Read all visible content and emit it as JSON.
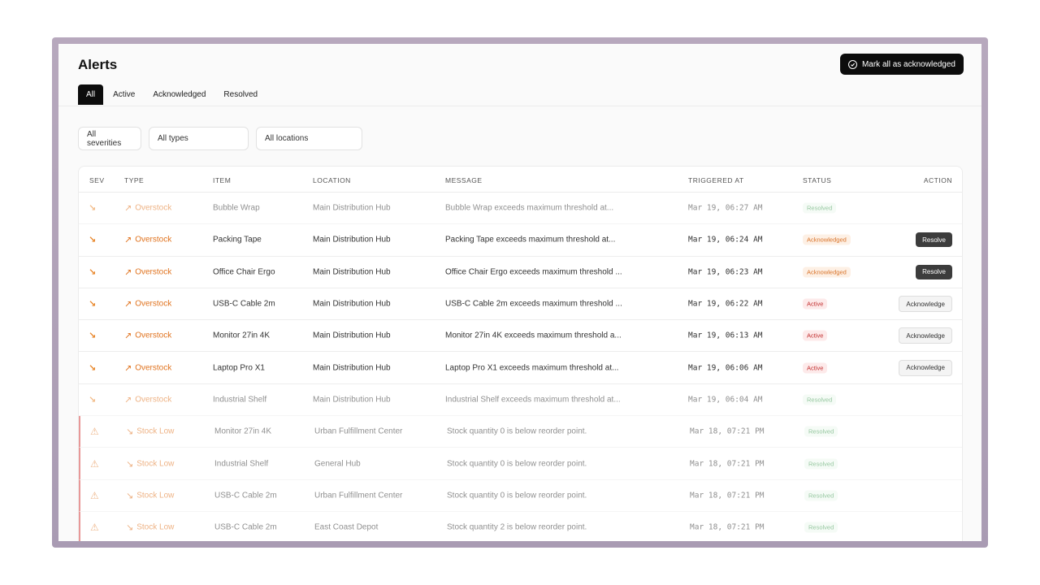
{
  "header": {
    "title": "Alerts",
    "mark_all_label": "Mark all as acknowledged"
  },
  "tabs": [
    {
      "label": "All"
    },
    {
      "label": "Active"
    },
    {
      "label": "Acknowledged"
    },
    {
      "label": "Resolved"
    }
  ],
  "filters": {
    "severity": "All severities",
    "type": "All types",
    "location": "All locations"
  },
  "columns": {
    "sev": "SEV",
    "type": "TYPE",
    "item": "ITEM",
    "location": "LOCATION",
    "message": "MESSAGE",
    "triggered_at": "TRIGGERED AT",
    "status": "STATUS",
    "action": "ACTION"
  },
  "rows": [
    {
      "type": "Overstock",
      "item": "Bubble Wrap",
      "location": "Main Distribution Hub",
      "message": "Bubble Wrap exceeds maximum threshold at...",
      "triggered_at": "Mar 19, 06:27 AM",
      "status": "Resolved",
      "action": ""
    },
    {
      "type": "Overstock",
      "item": "Packing Tape",
      "location": "Main Distribution Hub",
      "message": "Packing Tape exceeds maximum threshold at...",
      "triggered_at": "Mar 19, 06:24 AM",
      "status": "Acknowledged",
      "action": "Resolve"
    },
    {
      "type": "Overstock",
      "item": "Office Chair Ergo",
      "location": "Main Distribution Hub",
      "message": "Office Chair Ergo exceeds maximum threshold ...",
      "triggered_at": "Mar 19, 06:23 AM",
      "status": "Acknowledged",
      "action": "Resolve"
    },
    {
      "type": "Overstock",
      "item": "USB-C Cable 2m",
      "location": "Main Distribution Hub",
      "message": "USB-C Cable 2m exceeds maximum threshold ...",
      "triggered_at": "Mar 19, 06:22 AM",
      "status": "Active",
      "action": "Acknowledge"
    },
    {
      "type": "Overstock",
      "item": "Monitor 27in 4K",
      "location": "Main Distribution Hub",
      "message": "Monitor 27in 4K exceeds maximum threshold a...",
      "triggered_at": "Mar 19, 06:13 AM",
      "status": "Active",
      "action": "Acknowledge"
    },
    {
      "type": "Overstock",
      "item": "Laptop Pro X1",
      "location": "Main Distribution Hub",
      "message": "Laptop Pro X1 exceeds maximum threshold at...",
      "triggered_at": "Mar 19, 06:06 AM",
      "status": "Active",
      "action": "Acknowledge"
    },
    {
      "type": "Overstock",
      "item": "Industrial Shelf",
      "location": "Main Distribution Hub",
      "message": "Industrial Shelf exceeds maximum threshold at...",
      "triggered_at": "Mar 19, 06:04 AM",
      "status": "Resolved",
      "action": ""
    },
    {
      "type": "Stock Low",
      "item": "Monitor 27in 4K",
      "location": "Urban Fulfillment Center",
      "message": "Stock quantity 0 is below reorder point.",
      "triggered_at": "Mar 18, 07:21 PM",
      "status": "Resolved",
      "action": ""
    },
    {
      "type": "Stock Low",
      "item": "Industrial Shelf",
      "location": "General Hub",
      "message": "Stock quantity 0 is below reorder point.",
      "triggered_at": "Mar 18, 07:21 PM",
      "status": "Resolved",
      "action": ""
    },
    {
      "type": "Stock Low",
      "item": "USB-C Cable 2m",
      "location": "Urban Fulfillment Center",
      "message": "Stock quantity 0 is below reorder point.",
      "triggered_at": "Mar 18, 07:21 PM",
      "status": "Resolved",
      "action": ""
    },
    {
      "type": "Stock Low",
      "item": "USB-C Cable 2m",
      "location": "East Coast Depot",
      "message": "Stock quantity 2 is below reorder point.",
      "triggered_at": "Mar 18, 07:21 PM",
      "status": "Resolved",
      "action": ""
    }
  ]
}
